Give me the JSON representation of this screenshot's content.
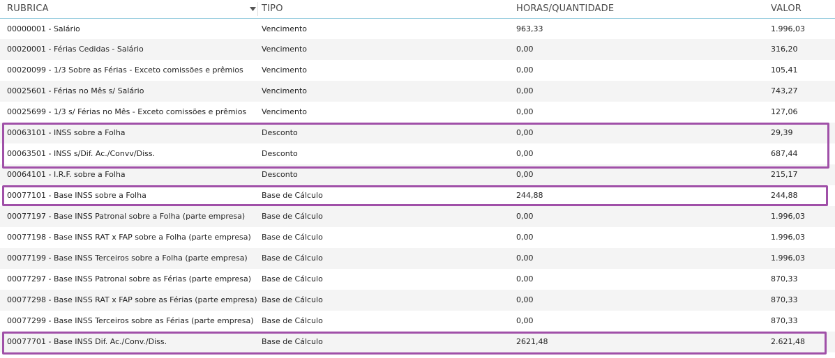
{
  "columns": {
    "rubrica": "RUBRICA",
    "tipo": "TIPO",
    "horas": "HORAS/QUANTIDADE",
    "valor": "VALOR"
  },
  "sort_icon": "sort-descending-icon",
  "highlight_color": "#a050a8",
  "rows": [
    {
      "rubrica": "00000001 - Salário",
      "tipo": "Vencimento",
      "horas": "963,33",
      "valor": "1.996,03"
    },
    {
      "rubrica": "00020001 - Férias Cedidas - Salário",
      "tipo": "Vencimento",
      "horas": "0,00",
      "valor": "316,20"
    },
    {
      "rubrica": "00020099 - 1/3 Sobre as Férias - Exceto comissões e prêmios",
      "tipo": "Vencimento",
      "horas": "0,00",
      "valor": "105,41"
    },
    {
      "rubrica": "00025601 - Férias no Mês s/ Salário",
      "tipo": "Vencimento",
      "horas": "0,00",
      "valor": "743,27"
    },
    {
      "rubrica": "00025699 - 1/3 s/ Férias no Mês - Exceto comissões e prêmios",
      "tipo": "Vencimento",
      "horas": "0,00",
      "valor": "127,06"
    },
    {
      "rubrica": "00063101 - INSS sobre a Folha",
      "tipo": "Desconto",
      "horas": "0,00",
      "valor": "29,39"
    },
    {
      "rubrica": "00063501 - INSS s/Dif. Ac./Convv/Diss.",
      "tipo": "Desconto",
      "horas": "0,00",
      "valor": "687,44"
    },
    {
      "rubrica": "00064101 - I.R.F. sobre a Folha",
      "tipo": "Desconto",
      "horas": "0,00",
      "valor": "215,17"
    },
    {
      "rubrica": "00077101 - Base INSS sobre a Folha",
      "tipo": "Base de Cálculo",
      "horas": "244,88",
      "valor": "244,88"
    },
    {
      "rubrica": "00077197 - Base INSS Patronal sobre a Folha (parte empresa)",
      "tipo": "Base de Cálculo",
      "horas": "0,00",
      "valor": "1.996,03"
    },
    {
      "rubrica": "00077198 - Base INSS RAT x FAP sobre a Folha (parte empresa)",
      "tipo": "Base de Cálculo",
      "horas": "0,00",
      "valor": "1.996,03"
    },
    {
      "rubrica": "00077199 - Base INSS Terceiros sobre a Folha (parte empresa)",
      "tipo": "Base de Cálculo",
      "horas": "0,00",
      "valor": "1.996,03"
    },
    {
      "rubrica": "00077297 - Base INSS Patronal sobre as Férias (parte empresa)",
      "tipo": "Base de Cálculo",
      "horas": "0,00",
      "valor": "870,33"
    },
    {
      "rubrica": "00077298 - Base INSS RAT x FAP sobre as Férias (parte empresa)",
      "tipo": "Base de Cálculo",
      "horas": "0,00",
      "valor": "870,33"
    },
    {
      "rubrica": "00077299 - Base INSS Terceiros sobre as Férias (parte empresa)",
      "tipo": "Base de Cálculo",
      "horas": "0,00",
      "valor": "870,33"
    },
    {
      "rubrica": "00077701 - Base INSS Dif. Ac./Conv./Diss.",
      "tipo": "Base de Cálculo",
      "horas": "2621,48",
      "valor": "2.621,48"
    }
  ]
}
